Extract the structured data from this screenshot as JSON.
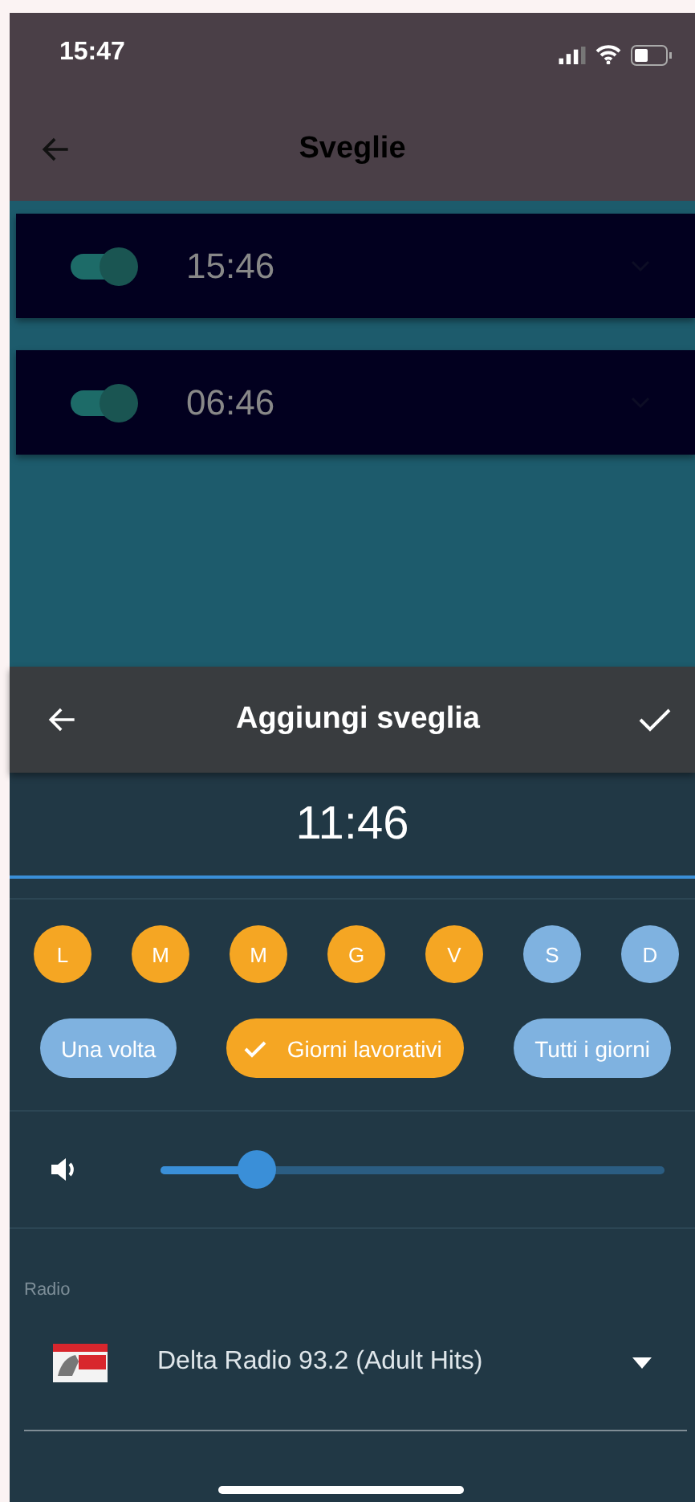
{
  "status_bar": {
    "time": "15:47"
  },
  "app_bar": {
    "title": "Sveglie"
  },
  "alarms": [
    {
      "time": "15:46",
      "enabled": true
    },
    {
      "time": "06:46",
      "enabled": true
    }
  ],
  "sheet": {
    "title": "Aggiungi sveglia",
    "time": "11:46",
    "days": [
      {
        "label": "L",
        "selected": true
      },
      {
        "label": "M",
        "selected": true
      },
      {
        "label": "M",
        "selected": true
      },
      {
        "label": "G",
        "selected": true
      },
      {
        "label": "V",
        "selected": true
      },
      {
        "label": "S",
        "selected": false
      },
      {
        "label": "D",
        "selected": false
      }
    ],
    "presets": [
      {
        "label": "Una volta",
        "selected": false
      },
      {
        "label": "Giorni lavorativi",
        "selected": true
      },
      {
        "label": "Tutti i giorni",
        "selected": false
      }
    ],
    "volume": {
      "level": 0.19
    },
    "radio": {
      "label": "Radio",
      "station": "Delta Radio 93.2 (Adult Hits)"
    }
  }
}
